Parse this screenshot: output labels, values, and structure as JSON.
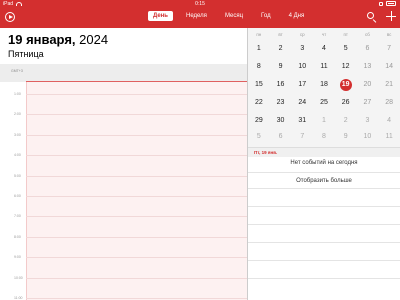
{
  "status_bar": {
    "carrier": "iPad",
    "time": "0:15",
    "battery": ""
  },
  "header": {
    "tabs": [
      {
        "label": "День",
        "active": true
      },
      {
        "label": "Неделя",
        "active": false
      },
      {
        "label": "Месяц",
        "active": false
      },
      {
        "label": "Год",
        "active": false
      },
      {
        "label": "4 Дня",
        "active": false
      }
    ],
    "accent_color": "#d32f2f"
  },
  "day_view": {
    "date_bold": "19 января,",
    "year": " 2024",
    "weekday": "Пятница",
    "timezone_label": "GMT+3",
    "hours": [
      "1:00",
      "2:00",
      "3:00",
      "4:00",
      "5:00",
      "6:00",
      "7:00",
      "8:00",
      "9:00",
      "10:00",
      "11:00"
    ]
  },
  "mini_calendar": {
    "weekdays": [
      "пн",
      "вт",
      "ср",
      "чт",
      "пт",
      "сб",
      "вс"
    ],
    "weeks": [
      [
        "1",
        "2",
        "3",
        "4",
        "5",
        "6",
        "7"
      ],
      [
        "8",
        "9",
        "10",
        "11",
        "12",
        "13",
        "14"
      ],
      [
        "15",
        "16",
        "17",
        "18",
        "19",
        "20",
        "21"
      ],
      [
        "22",
        "23",
        "24",
        "25",
        "26",
        "27",
        "28"
      ],
      [
        "29",
        "30",
        "31",
        "1",
        "2",
        "3",
        "4"
      ],
      [
        "5",
        "6",
        "7",
        "8",
        "9",
        "10",
        "11"
      ]
    ],
    "today": "19",
    "selected_day_label": "Пт, 19 янв."
  },
  "agenda": {
    "no_events_text": "Нет событий на сегодня",
    "show_more_label": "Отобразить больше"
  }
}
